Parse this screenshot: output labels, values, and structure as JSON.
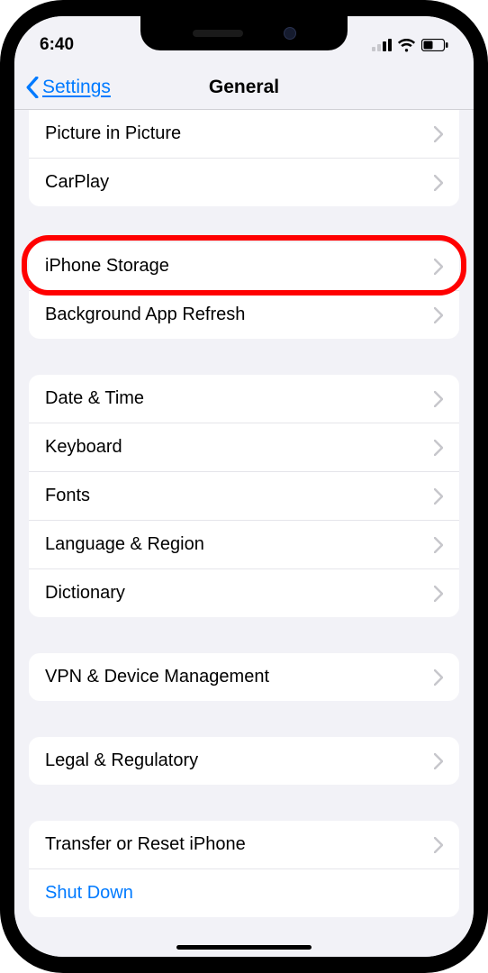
{
  "status_bar": {
    "time": "6:40"
  },
  "nav": {
    "back": "Settings",
    "title": "General"
  },
  "groups": [
    {
      "class": "first",
      "rows": [
        {
          "label": "Picture in Picture",
          "name": "row-picture-in-picture"
        },
        {
          "label": "CarPlay",
          "name": "row-carplay"
        }
      ]
    },
    {
      "rows": [
        {
          "label": "iPhone Storage",
          "name": "row-iphone-storage",
          "highlight": true
        },
        {
          "label": "Background App Refresh",
          "name": "row-background-app-refresh"
        }
      ]
    },
    {
      "rows": [
        {
          "label": "Date & Time",
          "name": "row-date-time"
        },
        {
          "label": "Keyboard",
          "name": "row-keyboard"
        },
        {
          "label": "Fonts",
          "name": "row-fonts"
        },
        {
          "label": "Language & Region",
          "name": "row-language-region"
        },
        {
          "label": "Dictionary",
          "name": "row-dictionary"
        }
      ]
    },
    {
      "rows": [
        {
          "label": "VPN & Device Management",
          "name": "row-vpn-device-management"
        }
      ]
    },
    {
      "rows": [
        {
          "label": "Legal & Regulatory",
          "name": "row-legal-regulatory"
        }
      ]
    },
    {
      "rows": [
        {
          "label": "Transfer or Reset iPhone",
          "name": "row-transfer-reset"
        },
        {
          "label": "Shut Down",
          "name": "row-shut-down",
          "noChevron": true,
          "class": "shutdown"
        }
      ]
    }
  ]
}
